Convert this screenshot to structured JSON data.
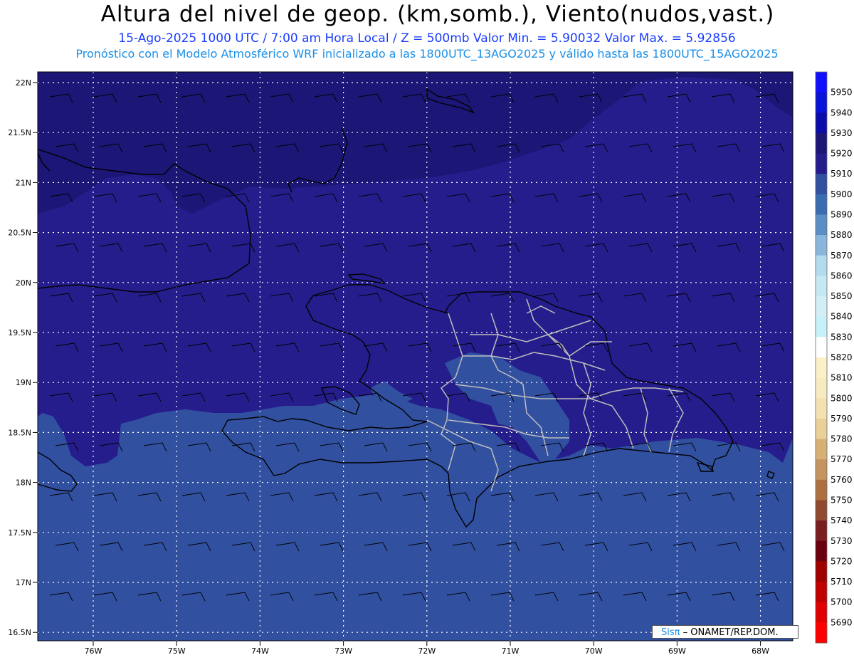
{
  "header": {
    "title": "Altura del nivel de geop. (km,somb.), Viento(nudos,vast.)",
    "line1": "15-Ago-2025  1000 UTC / 7:00 am Hora Local / Z = 500mb     Valor Min. = 5.90032  Valor Max. = 5.92856",
    "line2": "Pronóstico con el Modelo Atmosférico WRF inicializado a las 1800UTC_13AGO2025 y válido hasta las  1800UTC_15AGO2025"
  },
  "axes": {
    "lat_labels": [
      "22N",
      "21.5N",
      "21N",
      "20.5N",
      "20N",
      "19.5N",
      "19N",
      "18.5N",
      "18N",
      "17.5N",
      "17N",
      "16.5N"
    ],
    "lon_labels": [
      "76W",
      "75W",
      "74W",
      "73W",
      "72W",
      "71W",
      "70W",
      "69W",
      "68W"
    ]
  },
  "colorbar": {
    "levels": [
      {
        "value": "5950",
        "color": "#1010ff"
      },
      {
        "value": "5940",
        "color": "#0a14d8"
      },
      {
        "value": "5930",
        "color": "#0c0ca8"
      },
      {
        "value": "5920",
        "color": "#1c1676"
      },
      {
        "value": "5910",
        "color": "#261d8c"
      },
      {
        "value": "5900",
        "color": "#3150a0"
      },
      {
        "value": "5890",
        "color": "#3a6cb0"
      },
      {
        "value": "5880",
        "color": "#5b8fc4"
      },
      {
        "value": "5870",
        "color": "#8ab6dc"
      },
      {
        "value": "5860",
        "color": "#b3dbee"
      },
      {
        "value": "5850",
        "color": "#c6e8f2"
      },
      {
        "value": "5840",
        "color": "#d4eef6"
      },
      {
        "value": "5830",
        "color": "#c7f0f8"
      },
      {
        "value": "5820",
        "color": "#ffffff"
      },
      {
        "value": "5810",
        "color": "#fbf0c8"
      },
      {
        "value": "5800",
        "color": "#f7ebc2"
      },
      {
        "value": "5790",
        "color": "#f3e1b2"
      },
      {
        "value": "5780",
        "color": "#e9cf98"
      },
      {
        "value": "5770",
        "color": "#d7b078"
      },
      {
        "value": "5760",
        "color": "#c49460"
      },
      {
        "value": "5750",
        "color": "#ad7040"
      },
      {
        "value": "5740",
        "color": "#8f4a30"
      },
      {
        "value": "5730",
        "color": "#7a1e22"
      },
      {
        "value": "5720",
        "color": "#6a0010"
      },
      {
        "value": "5710",
        "color": "#9e0000"
      },
      {
        "value": "5700",
        "color": "#c00000"
      },
      {
        "value": "5690",
        "color": "#e00000"
      },
      {
        "value": "",
        "color": "#ff0000"
      }
    ]
  },
  "field_colors": {
    "high": "#1c1676",
    "mid": "#261d8c",
    "low": "#3150a0",
    "coast": "#000000",
    "border": "#bdbdbd",
    "grid": "#ffffff"
  },
  "credit": {
    "logo": "Sisπ",
    "text": "– ONAMET/REP.DOM."
  }
}
